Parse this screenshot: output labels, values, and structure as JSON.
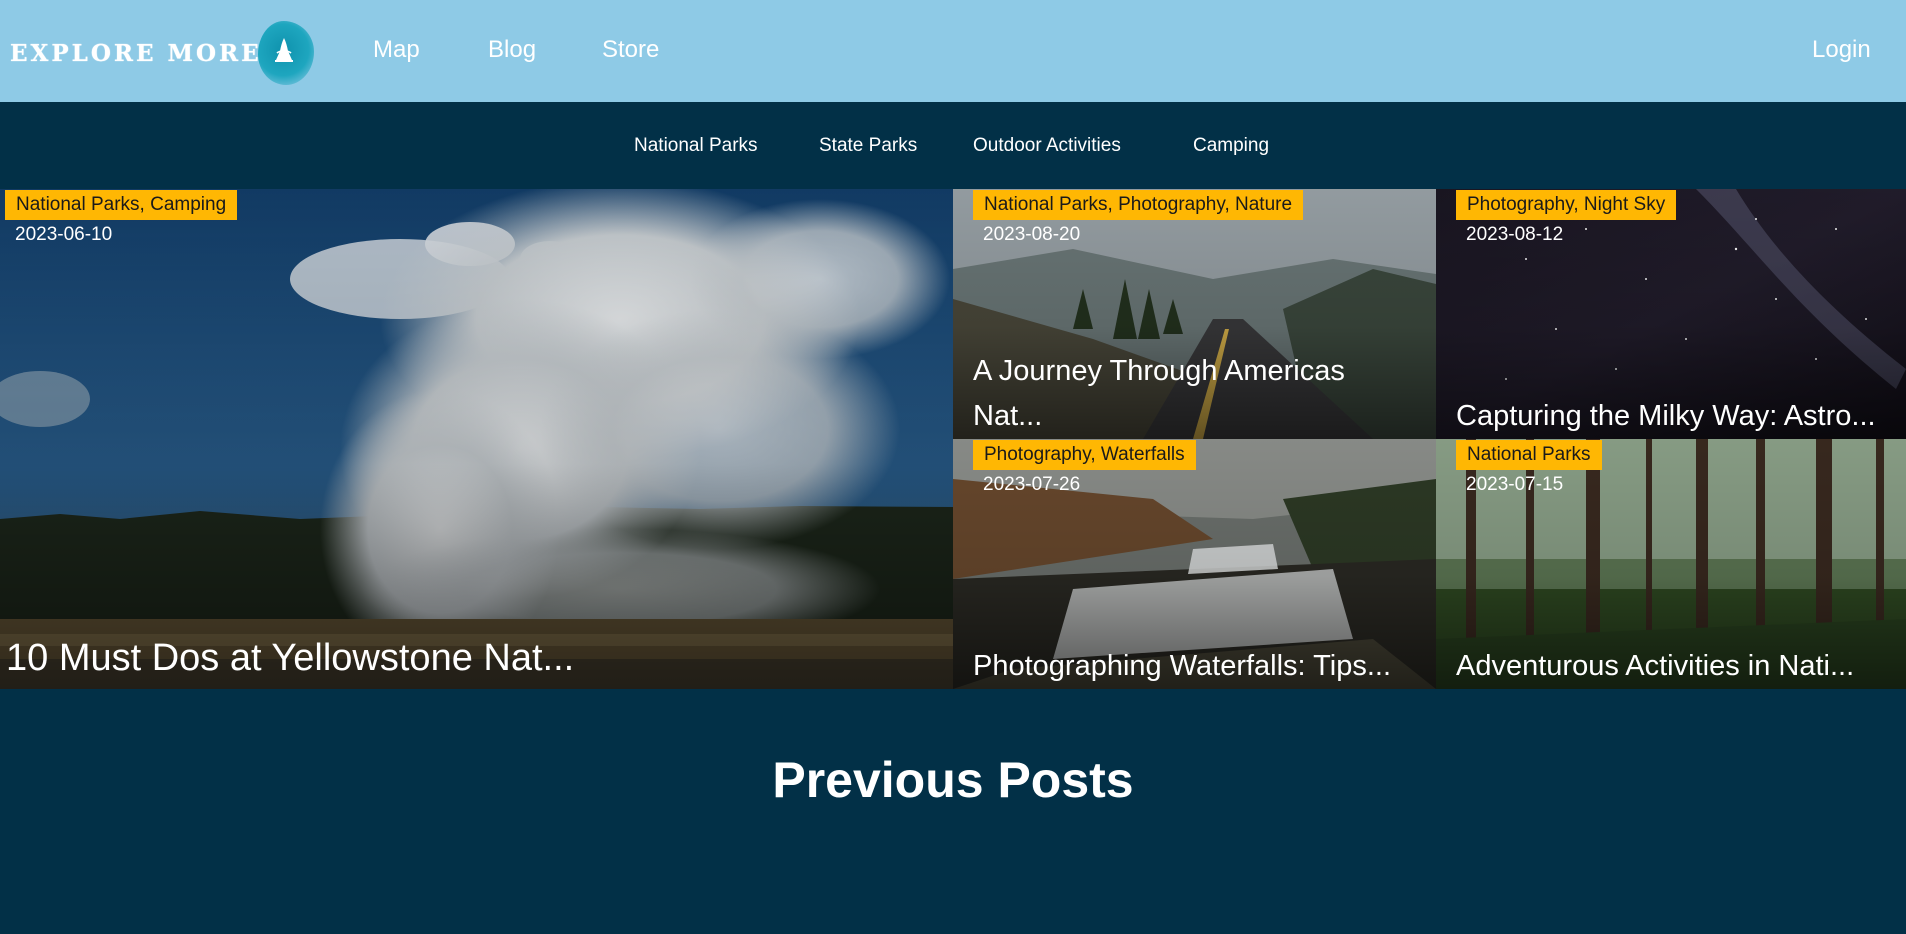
{
  "brand": {
    "name": "EXPLORE MORE",
    "accent": "#8ecae6",
    "dark": "#023047",
    "tag_color": "#ffb703"
  },
  "header": {
    "nav": [
      "Map",
      "Blog",
      "Store"
    ],
    "login_label": "Login"
  },
  "categories": [
    "National Parks",
    "State Parks",
    "Outdoor Activities",
    "Camping"
  ],
  "posts": [
    {
      "tags": "National Parks, Camping",
      "date": "2023-06-10",
      "title": "10 Must Dos at Yellowstone Nat..."
    },
    {
      "tags": "National Parks, Photography, Nature",
      "date": "2023-08-20",
      "title_line1": "A Journey Through Americas",
      "title_line2": "Nat..."
    },
    {
      "tags": "Photography, Night Sky",
      "date": "2023-08-12",
      "title": "Capturing the Milky Way: Astro..."
    },
    {
      "tags": "Photography, Waterfalls",
      "date": "2023-07-26",
      "title": "Photographing Waterfalls: Tips..."
    },
    {
      "tags": "National Parks",
      "date": "2023-07-15",
      "title": "Adventurous Activities in Nati..."
    }
  ],
  "previous": {
    "heading": "Previous Posts"
  }
}
